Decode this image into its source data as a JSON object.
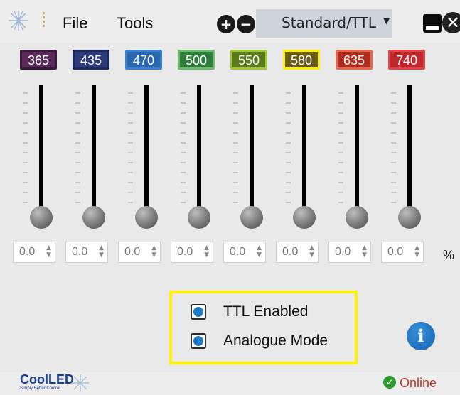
{
  "menu": {
    "file": "File",
    "tools": "Tools"
  },
  "toolbar": {
    "add_icon": "plus-circle-icon",
    "remove_icon": "minus-circle-icon",
    "minimize_icon": "minimize-icon",
    "close_icon": "close-icon"
  },
  "mode": {
    "selected": "Standard/TTL"
  },
  "channels": [
    {
      "wavelength": "365",
      "bg": "#5a2a5a",
      "border": "#3a1a3a",
      "value": "0.0"
    },
    {
      "wavelength": "435",
      "bg": "#2c3a78",
      "border": "#1e2a5a",
      "value": "0.0"
    },
    {
      "wavelength": "470",
      "bg": "#2a66ad",
      "border": "#3d7fc8",
      "value": "0.0"
    },
    {
      "wavelength": "500",
      "bg": "#2f7d3a",
      "border": "#6bbd6b",
      "value": "0.0"
    },
    {
      "wavelength": "550",
      "bg": "#5a7a1e",
      "border": "#a3c53a",
      "value": "0.0"
    },
    {
      "wavelength": "580",
      "bg": "#6a5a1a",
      "border": "#fff200",
      "value": "0.0"
    },
    {
      "wavelength": "635",
      "bg": "#b02c20",
      "border": "#e06b4a",
      "value": "0.0"
    },
    {
      "wavelength": "740",
      "bg": "#c0272d",
      "border": "#d94848",
      "value": "0.0"
    }
  ],
  "unit": "%",
  "ttl": {
    "ttl_enabled": "TTL Enabled",
    "analogue_mode": "Analogue Mode",
    "highlight": "#fff200"
  },
  "info_button": "i",
  "brand": {
    "name": "CoolLED",
    "tagline": "Simply Better Control"
  },
  "status": {
    "state": "Online",
    "color": "#c0392b",
    "icon": "check-circle-icon"
  }
}
